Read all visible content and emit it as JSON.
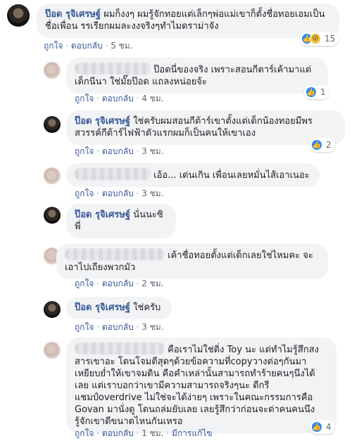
{
  "ui": {
    "like": "ถูกใจ",
    "reply": "ตอบกลับ",
    "dot": " · ",
    "edited": "มีการแก้ไข"
  },
  "comments": [
    {
      "author": "ป๊อด รุจิเศรษฐ์",
      "text": "ผมก็งงๆ ผมรู้จักทอยแต่เล็กๆพ่อแม่เขาก็ตั้งชื่อทอยเอมเป็นชื่อเพื่อน รรเรียกผมละงงจริงๆทำไมดราม่าจัง",
      "time": "5 ชม.",
      "reactions": "15",
      "reaction_icons": [
        "like-icon",
        "wow-icon"
      ]
    },
    {
      "author": "",
      "text": "ป๊อดนี่ของจริง เพราะสอนกีตาร์เค้ามาแต่เด็กนีนา ใช่มั๊ยป๊อด แถลงหน่อยจ้ะ",
      "time": "4 ชม.",
      "reactions": "1"
    },
    {
      "author": "ป๊อด รุจิเศรษฐ์",
      "text": "ใช่ครับผมสอนกีต้าร์เขาตั้งแต่เด็กน้องทอยมีพรสวรรค์กีต้าร์ไฟฟ้าตัวแรกผมก็เป็นคนให้เขาเอง",
      "time": "3 ชม.",
      "reactions": "2"
    },
    {
      "author": "",
      "text": "เอ้อ... เด่นเกิน เพื่อนเลยหมั่นไส้เอาเนอะ",
      "time": "3 ชม."
    },
    {
      "author": "ป๊อด รุจิเศรษฐ์",
      "text": "นั่นนะซิพี่",
      "time": ""
    },
    {
      "author": "",
      "text": "เค้าชื่อทอยตั้งแต่เด็กเลยใช่ไหมคะ จะเอาไปเถียงพวกมัว",
      "time": "2 ชม."
    },
    {
      "author": "ป๊อด รุจิเศรษฐ์",
      "text": "ใช่ครับ",
      "time": "3 ชม."
    },
    {
      "author": "",
      "text": "คือเราไม่ใช่ติ่ง Toy นะ แต่ทำไมรู้สึกสงสารเขาอะ โดนโจมตีสุดๆด้วยข้อความที่copyวางต่อๆกันมาเหยียบย่ำให้เขาจมดิน คือคำเหล่านั้นสามารถทำร้ายคนๆนึงได้เลย แต่เราบอกว่าเขามีความสามารถจริงๆนะ ดีกรีแชมป์overdrive ไม่ใช่จะได้ง่ายๆ เพราะในคณะกรรมการคือ Govan มานั่งดู โดนถล่มยับเลย เลยรู้สึกว่าก่อนจะด่าคนคนนึงรู้จักเขาดีขนาดไหนกันเหรอ",
      "time": "1 ชม.",
      "reactions": "4"
    }
  ]
}
